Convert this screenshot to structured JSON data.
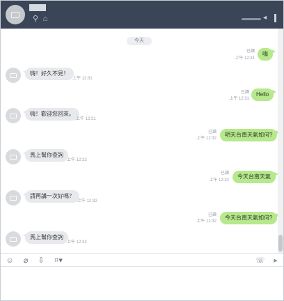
{
  "header": {
    "search_icon": "search-icon",
    "home_icon": "home-icon",
    "volume_icon": "speaker-icon"
  },
  "chat": {
    "date_label": "今天",
    "messages": [
      {
        "direction": "out",
        "text": "嗨",
        "read": "已讀",
        "time": "上午 12:31"
      },
      {
        "direction": "in",
        "text": "嗨！好久不見！",
        "time": "上午 12:31"
      },
      {
        "direction": "out",
        "text": "Hello",
        "read": "已讀",
        "time": "上午 12:31"
      },
      {
        "direction": "in",
        "text": "嗨！歡迎您回來。",
        "time": "上午 12:31"
      },
      {
        "direction": "out",
        "text": "明天台南天氣如何?",
        "read": "已讀",
        "time": "上午 12:32"
      },
      {
        "direction": "in",
        "text": "馬上幫你查詢",
        "time": "上午 12:32"
      },
      {
        "direction": "out",
        "text": "今天台南天氣",
        "read": "已讀",
        "time": "上午 12:32"
      },
      {
        "direction": "in",
        "text": "請再講一次好嗎？",
        "time": "上午 12:32"
      },
      {
        "direction": "out",
        "text": "今天台南天氣如何?",
        "read": "已讀",
        "time": "上午 12:32"
      },
      {
        "direction": "in",
        "text": "馬上幫你查詢",
        "time": "上午 12:32"
      }
    ]
  },
  "toolbar": {
    "tools": [
      "emoji-icon",
      "attach-icon",
      "download-icon",
      "crop-icon"
    ],
    "right_tools": [
      "phone-icon",
      "send-icon"
    ]
  },
  "colors": {
    "header_bg": "#3a4558",
    "outgoing_bubble": "#b6e88d",
    "incoming_bubble": "#e7e9ec"
  }
}
